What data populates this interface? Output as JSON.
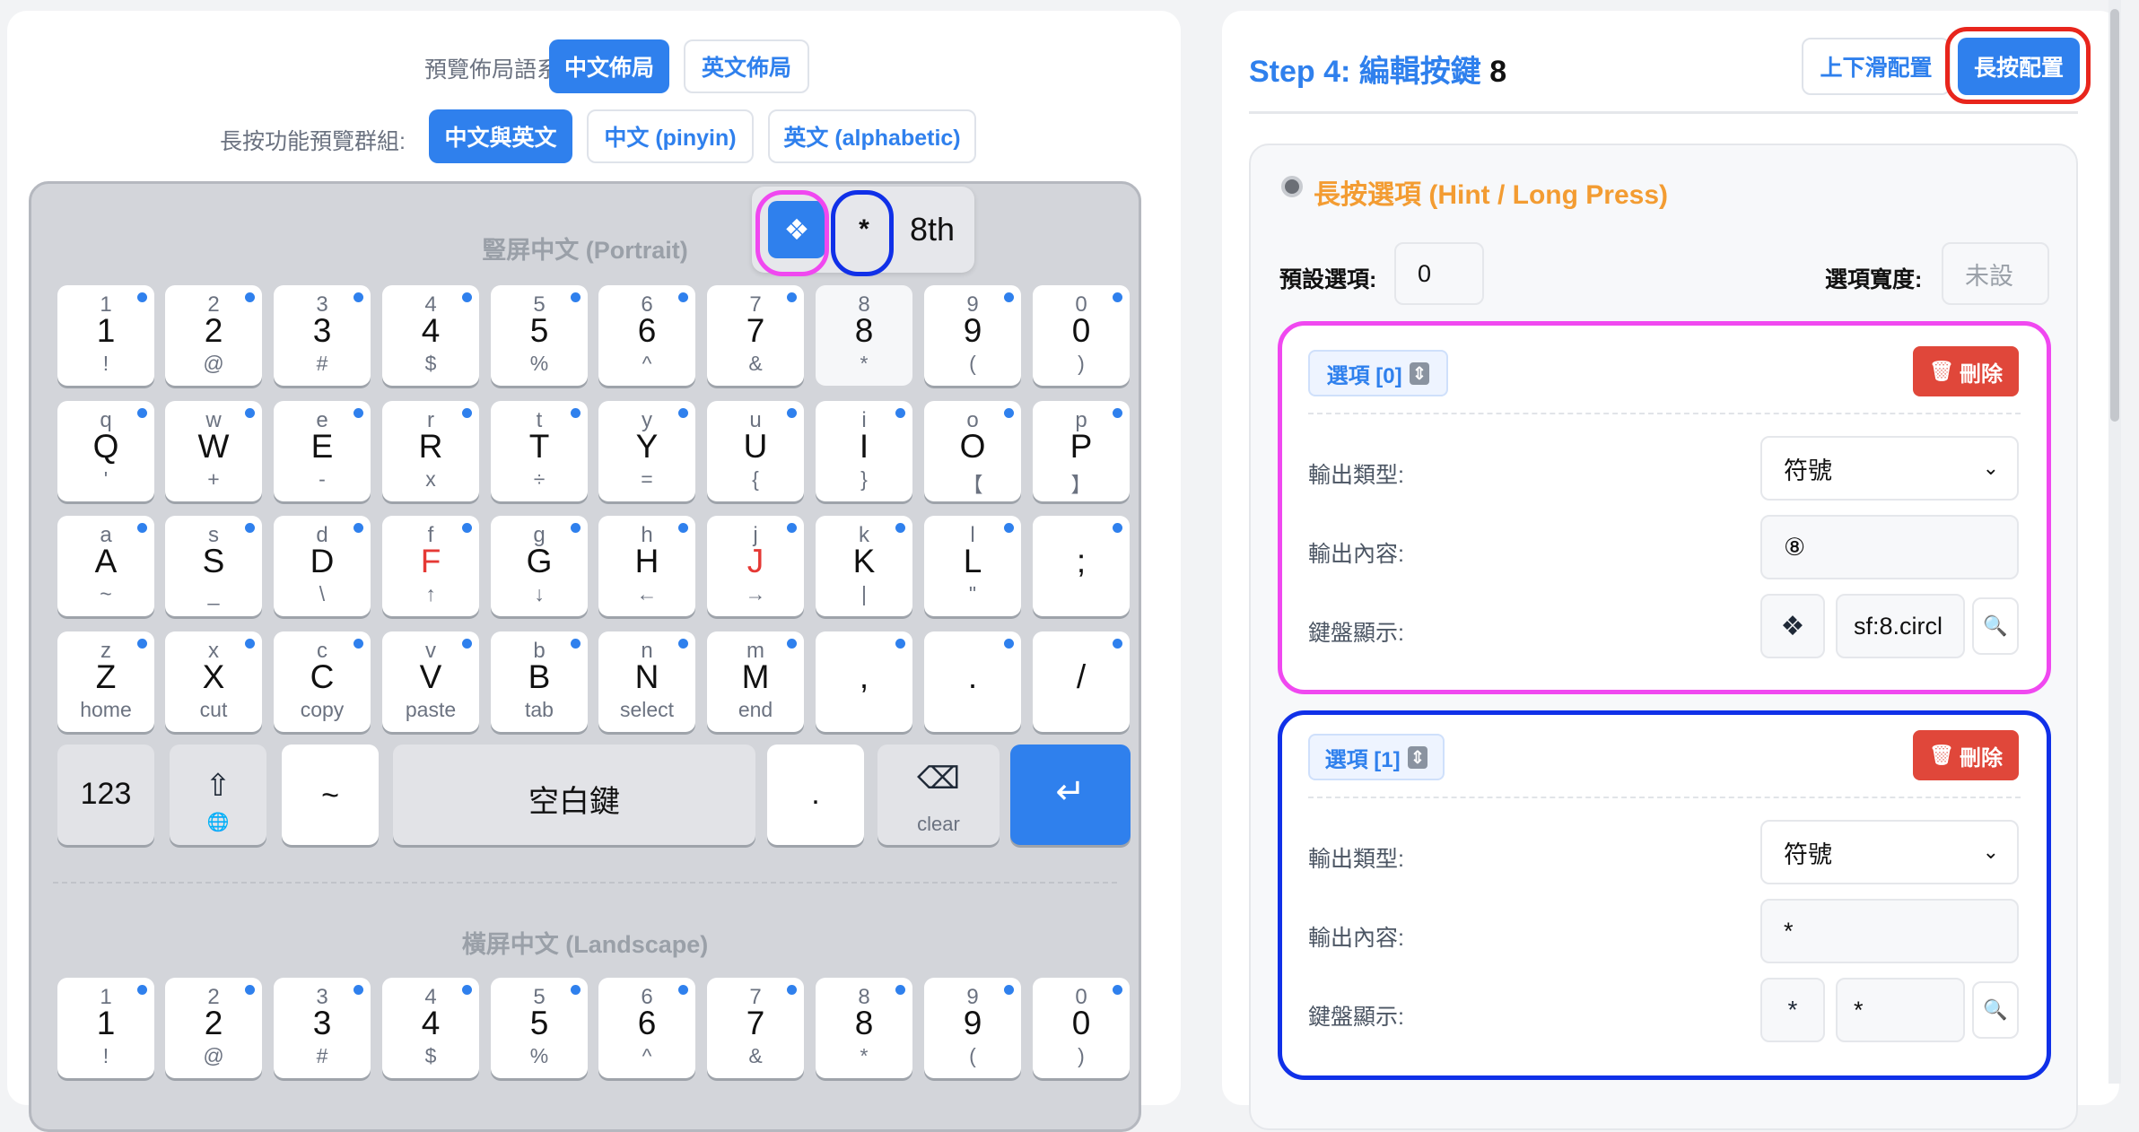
{
  "layout_language": {
    "label": "預覽佈局語系:",
    "options": [
      {
        "label": "中文佈局",
        "active": true
      },
      {
        "label": "英文佈局",
        "active": false
      }
    ]
  },
  "longpress_group": {
    "label": "長按功能預覽群組:",
    "options": [
      {
        "label": "中文與英文",
        "active": true
      },
      {
        "label": "中文 (pinyin)",
        "active": false
      },
      {
        "label": "英文 (alphabetic)",
        "active": false
      }
    ]
  },
  "keyboard": {
    "portrait_title": "豎屏中文 (Portrait)",
    "landscape_title": "橫屏中文 (Landscape)",
    "rows": [
      [
        {
          "hint": "1",
          "main": "1",
          "sub": "!"
        },
        {
          "hint": "2",
          "main": "2",
          "sub": "@"
        },
        {
          "hint": "3",
          "main": "3",
          "sub": "#"
        },
        {
          "hint": "4",
          "main": "4",
          "sub": "$"
        },
        {
          "hint": "5",
          "main": "5",
          "sub": "%"
        },
        {
          "hint": "6",
          "main": "6",
          "sub": "^"
        },
        {
          "hint": "7",
          "main": "7",
          "sub": "&"
        },
        {
          "hint": "8",
          "main": "8",
          "sub": "*"
        },
        {
          "hint": "9",
          "main": "9",
          "sub": "("
        },
        {
          "hint": "0",
          "main": "0",
          "sub": ")"
        }
      ],
      [
        {
          "hint": "q",
          "main": "Q",
          "sub": "'"
        },
        {
          "hint": "w",
          "main": "W",
          "sub": "+"
        },
        {
          "hint": "e",
          "main": "E",
          "sub": "-"
        },
        {
          "hint": "r",
          "main": "R",
          "sub": "x"
        },
        {
          "hint": "t",
          "main": "T",
          "sub": "÷"
        },
        {
          "hint": "y",
          "main": "Y",
          "sub": "="
        },
        {
          "hint": "u",
          "main": "U",
          "sub": "{"
        },
        {
          "hint": "i",
          "main": "I",
          "sub": "}"
        },
        {
          "hint": "o",
          "main": "O",
          "sub": "【"
        },
        {
          "hint": "p",
          "main": "P",
          "sub": "】"
        }
      ],
      [
        {
          "hint": "a",
          "main": "A",
          "sub": "~"
        },
        {
          "hint": "s",
          "main": "S",
          "sub": "_"
        },
        {
          "hint": "d",
          "main": "D",
          "sub": "\\"
        },
        {
          "hint": "f",
          "main": "F",
          "sub": "↑"
        },
        {
          "hint": "g",
          "main": "G",
          "sub": "↓"
        },
        {
          "hint": "h",
          "main": "H",
          "sub": "←"
        },
        {
          "hint": "j",
          "main": "J",
          "sub": "→"
        },
        {
          "hint": "k",
          "main": "K",
          "sub": "|"
        },
        {
          "hint": "l",
          "main": "L",
          "sub": "\""
        },
        {
          "hint": "",
          "main": ";",
          "sub": ""
        }
      ],
      [
        {
          "hint": "z",
          "main": "Z",
          "sub": "home"
        },
        {
          "hint": "x",
          "main": "X",
          "sub": "cut"
        },
        {
          "hint": "c",
          "main": "C",
          "sub": "copy"
        },
        {
          "hint": "v",
          "main": "V",
          "sub": "paste"
        },
        {
          "hint": "b",
          "main": "B",
          "sub": "tab"
        },
        {
          "hint": "n",
          "main": "N",
          "sub": "select"
        },
        {
          "hint": "m",
          "main": "M",
          "sub": "end"
        },
        {
          "hint": "",
          "main": ",",
          "sub": ""
        },
        {
          "hint": "",
          "main": ".",
          "sub": ""
        },
        {
          "hint": "",
          "main": "/",
          "sub": ""
        }
      ]
    ],
    "bottom": {
      "k123": "123",
      "tilde": "~",
      "space": "空白鍵",
      "period": ".",
      "clear": "clear"
    },
    "popup": {
      "item0": "❖",
      "item1": "*",
      "name": "8th"
    }
  },
  "editor": {
    "title_prefix": "Step 4: 編輯按鍵",
    "key": "8",
    "swipe_button": "上下滑配置",
    "longpress_button": "長按配置",
    "section_title": "長按選項 (Hint / Long Press)",
    "default_label": "預設選項:",
    "default_value": "0",
    "width_label": "選項寬度:",
    "width_placeholder": "未設",
    "type_label": "輸出類型:",
    "content_label": "輸出內容:",
    "display_label": "鍵盤顯示:",
    "delete_label": "刪除",
    "options": [
      {
        "badge": "選項 [0]",
        "type": "符號",
        "content": "⑧",
        "display_icon": "❖",
        "display_text": "sf:8.circl"
      },
      {
        "badge": "選項 [1]",
        "type": "符號",
        "content": "*",
        "display_icon": "*",
        "display_text": "*"
      }
    ]
  },
  "colors": {
    "accent": "#2f80ed",
    "section_title": "#f39c32",
    "highlight_magenta": "#f048f0",
    "highlight_blue": "#1030e8",
    "highlight_red": "#e8251c",
    "delete_red": "#e0473a"
  }
}
